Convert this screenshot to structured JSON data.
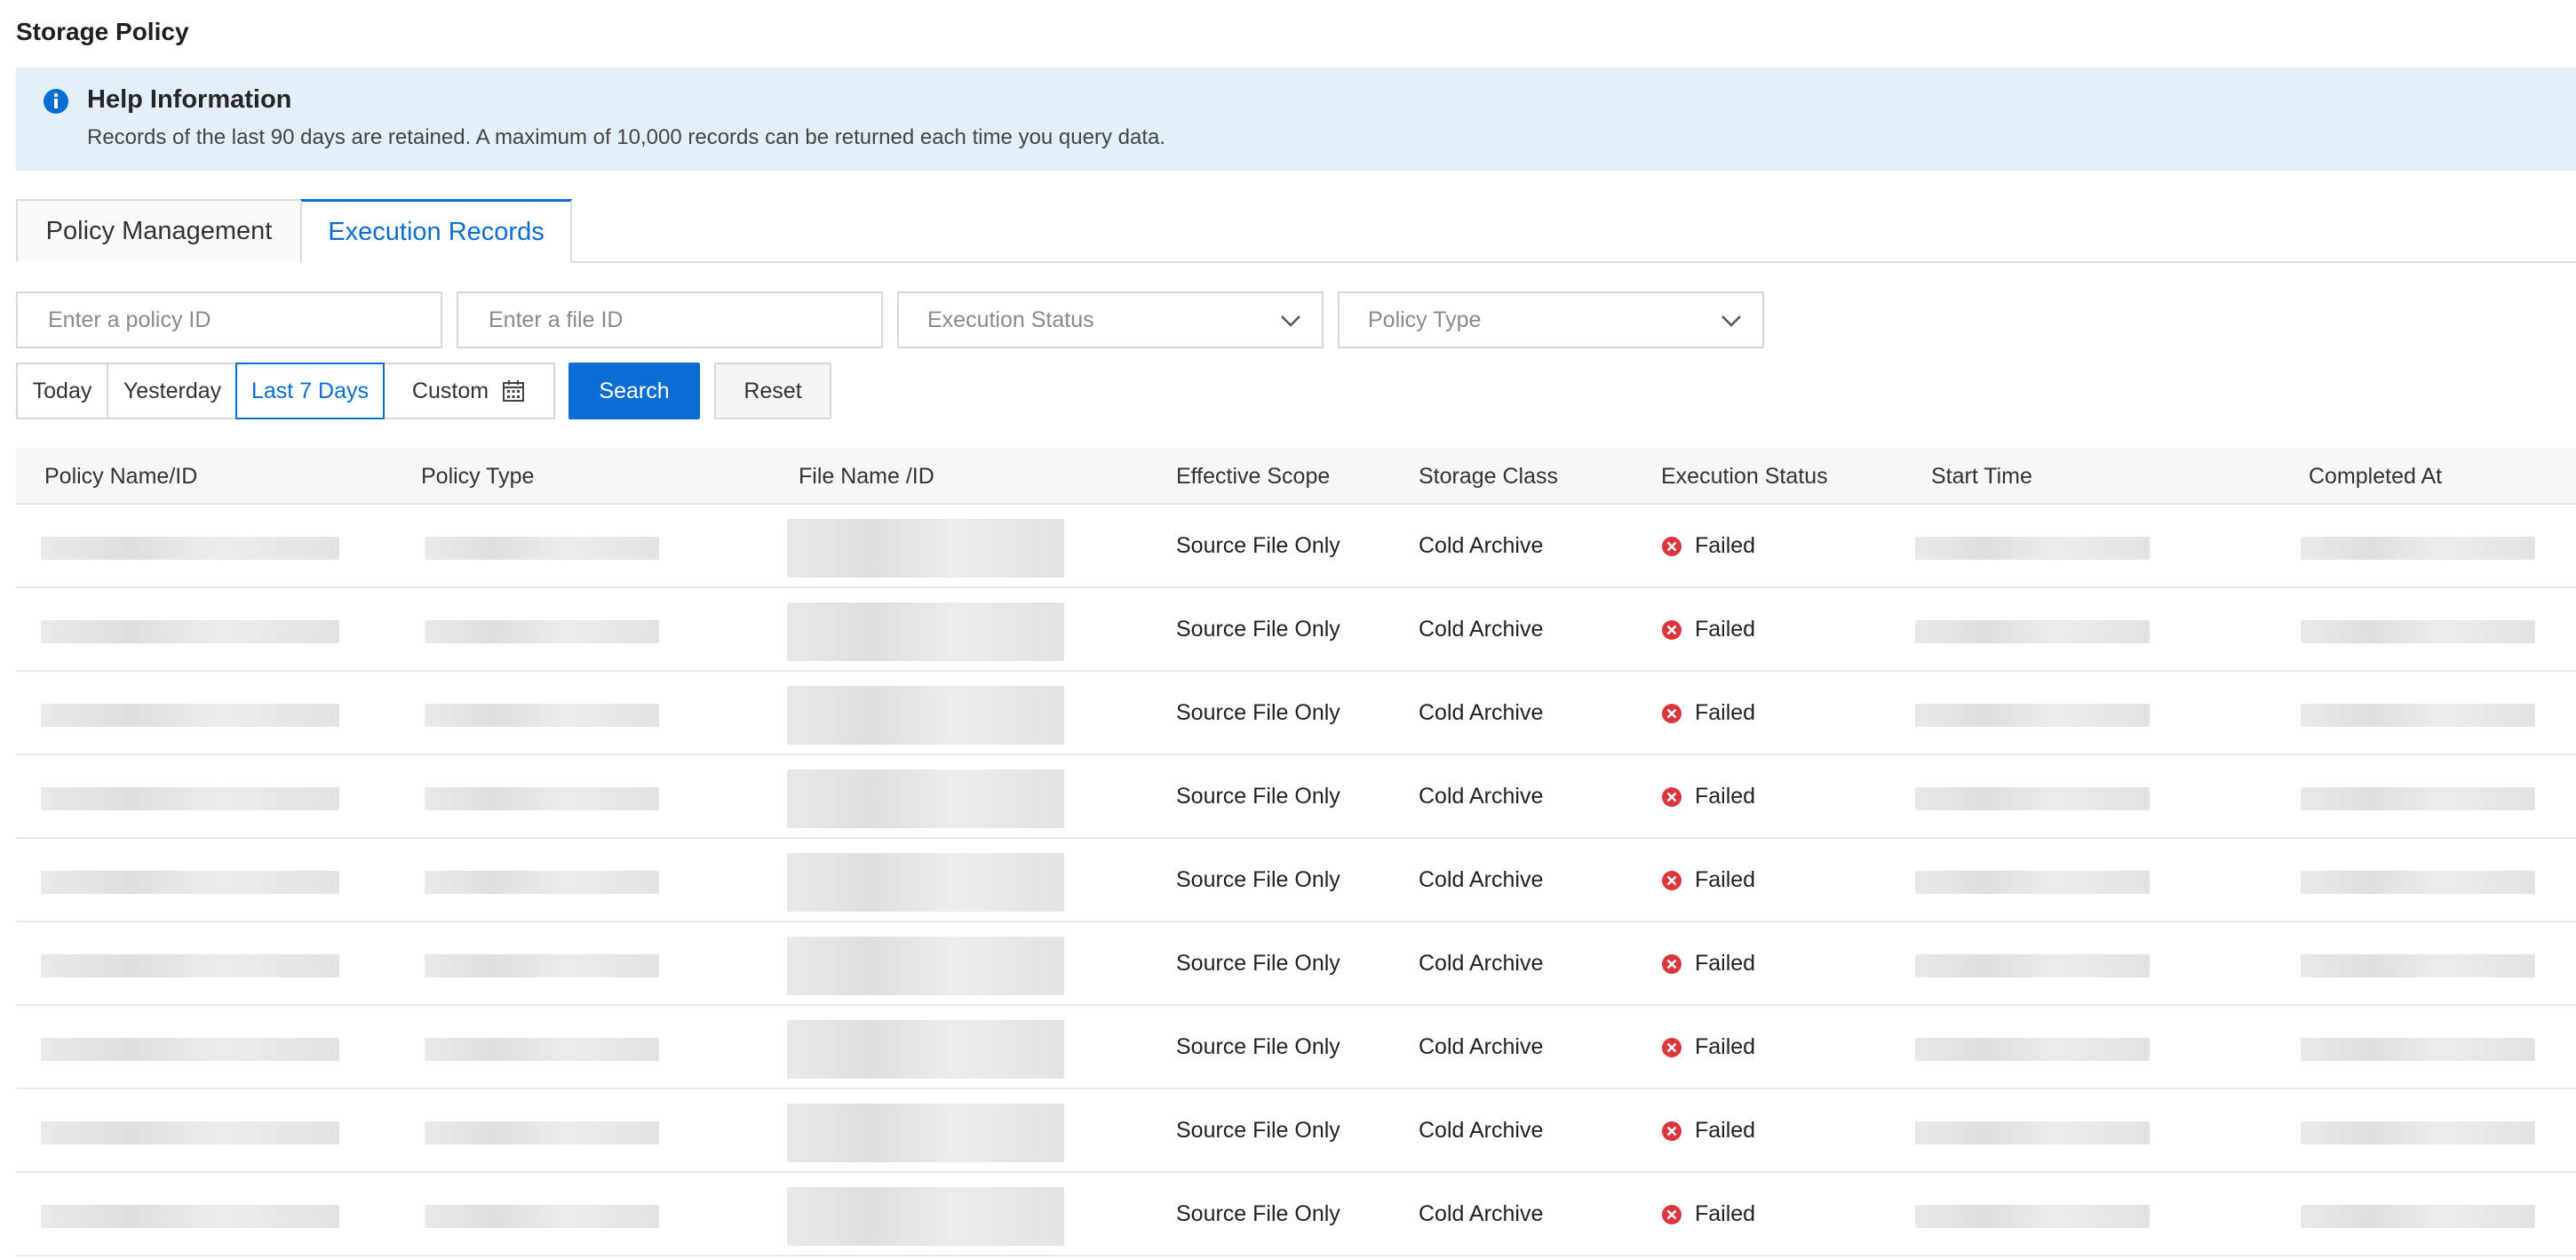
{
  "page_title": "Storage Policy",
  "help": {
    "title": "Help Information",
    "body": "Records of the last 90 days are retained. A maximum of 10,000 records can be returned each time you query data.",
    "icon": "info-icon"
  },
  "tabs": [
    {
      "label": "Policy Management",
      "active": false
    },
    {
      "label": "Execution Records",
      "active": true
    }
  ],
  "filters": {
    "policy_id_placeholder": "Enter a policy ID",
    "file_id_placeholder": "Enter a file ID",
    "execution_status_placeholder": "Execution Status",
    "policy_type_placeholder": "Policy Type"
  },
  "date_range": {
    "today": "Today",
    "yesterday": "Yesterday",
    "last7": "Last 7 Days",
    "custom": "Custom",
    "selected": "Last 7 Days"
  },
  "buttons": {
    "search": "Search",
    "reset": "Reset"
  },
  "colors": {
    "accent": "#0a6dd1",
    "failed": "#d9363e",
    "banner": "#e3f0fc"
  },
  "table": {
    "columns": [
      "Policy Name/ID",
      "Policy Type",
      "File Name /ID",
      "Effective Scope",
      "Storage Class",
      "Execution Status",
      "Start Time",
      "Completed At"
    ],
    "rows": [
      {
        "scope": "Source File Only",
        "storage_class": "Cold Archive",
        "status": "Failed"
      },
      {
        "scope": "Source File Only",
        "storage_class": "Cold Archive",
        "status": "Failed"
      },
      {
        "scope": "Source File Only",
        "storage_class": "Cold Archive",
        "status": "Failed"
      },
      {
        "scope": "Source File Only",
        "storage_class": "Cold Archive",
        "status": "Failed"
      },
      {
        "scope": "Source File Only",
        "storage_class": "Cold Archive",
        "status": "Failed"
      },
      {
        "scope": "Source File Only",
        "storage_class": "Cold Archive",
        "status": "Failed"
      },
      {
        "scope": "Source File Only",
        "storage_class": "Cold Archive",
        "status": "Failed"
      },
      {
        "scope": "Source File Only",
        "storage_class": "Cold Archive",
        "status": "Failed"
      },
      {
        "scope": "Source File Only",
        "storage_class": "Cold Archive",
        "status": "Failed"
      }
    ]
  }
}
